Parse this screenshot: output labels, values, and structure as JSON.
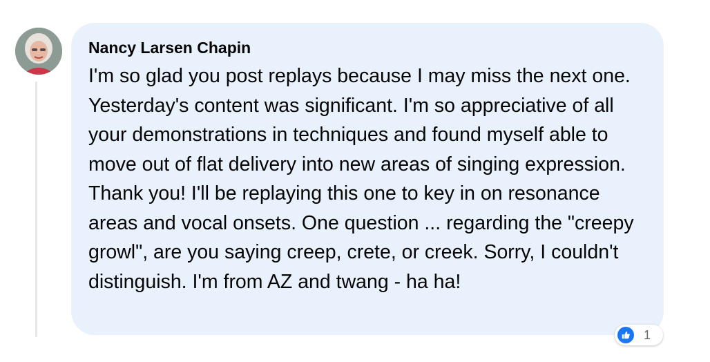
{
  "comment": {
    "author": "Nancy Larsen Chapin",
    "text": "I'm so glad you post replays because I may miss the next one. Yesterday's content was significant. I'm so appreciative of all your demonstrations in techniques and found myself able to move out of flat delivery into new areas of singing expression. Thank you! I'll be replaying this one to key in on resonance areas and vocal onsets. One question ... regarding the \"creepy growl\", are you saying creep, crete, or creek. Sorry, I couldn't distinguish. I'm from AZ and twang - ha ha!",
    "reactions": {
      "icon": "thumbs-up-icon",
      "count": "1"
    }
  },
  "colors": {
    "bubble_bg": "#e8f1fc",
    "text": "#050505",
    "like_blue": "#1877f2"
  }
}
